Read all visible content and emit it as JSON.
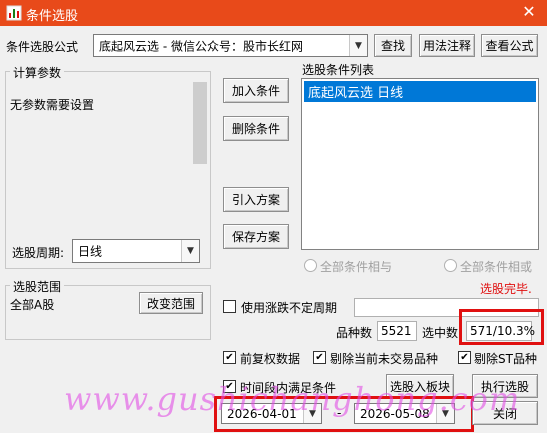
{
  "window": {
    "title": "条件选股",
    "close_glyph": "✕"
  },
  "formula": {
    "label": "条件选股公式",
    "selected": "底起风云选  -  微信公众号：股市长红网",
    "buttons": {
      "find": "查找",
      "usage": "用法注释",
      "view": "查看公式"
    }
  },
  "params": {
    "group_title": "计算参数",
    "text": "无参数需要设置",
    "period_label": "选股周期:",
    "period_value": "日线"
  },
  "actions": {
    "add": "加入条件",
    "delete": "删除条件",
    "import": "引入方案",
    "save": "保存方案"
  },
  "conditions": {
    "title": "选股条件列表",
    "items": [
      "底起风云选  日线"
    ],
    "mode_and": "全部条件相与",
    "mode_or": "全部条件相或"
  },
  "status": {
    "done_text": "选股完毕."
  },
  "range": {
    "group_title": "选股范围",
    "value": "全部A股",
    "change_button": "改变范围"
  },
  "options": {
    "variable_period_label": "使用涨跌不定周期",
    "count_label": "品种数",
    "count_value": "5521",
    "selected_label": "选中数",
    "selected_value": "571/10.3%",
    "pre_adjust": "前复权数据",
    "exclude_untraded": "剔除当前未交易品种",
    "exclude_st": "剔除ST品种",
    "time_range": "时间段内满足条件"
  },
  "bottom": {
    "to_block_button": "选股入板块",
    "execute_button": "执行选股",
    "date_from": "2026-04-01",
    "date_sep": "-",
    "date_to": "2026-05-08",
    "close_button": "关闭"
  },
  "watermark": {
    "text": "www.gushichanghong.com",
    "color": "#e24fe6"
  },
  "colors": {
    "titlebar": "#e84a1a",
    "selection": "#0078d7",
    "highlight_frame": "#e01010",
    "status_red": "#e01010"
  },
  "icons": {
    "window": "app-icon",
    "dropdown": "chevron-down-icon"
  }
}
